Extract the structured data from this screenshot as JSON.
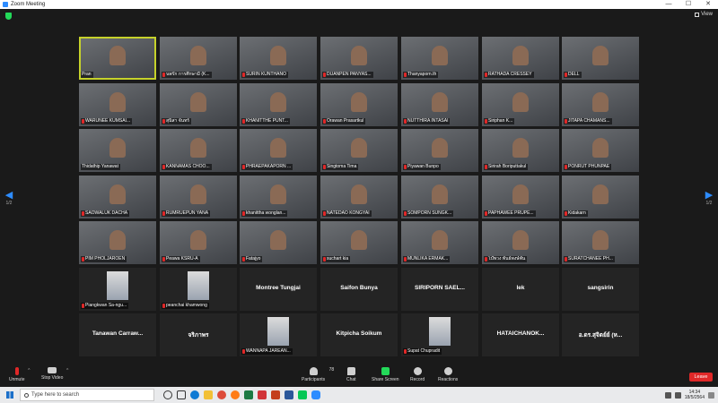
{
  "window": {
    "title": "Zoom Meeting",
    "controls": [
      "—",
      "☐",
      "✕"
    ]
  },
  "topbar": {
    "view_label": "View"
  },
  "pager": {
    "left_page": "1/2",
    "right_page": "1/2",
    "left_arrow": "◀",
    "right_arrow": "▶"
  },
  "tiles": [
    {
      "name": "Pran",
      "type": "video",
      "muted": false,
      "active": true
    },
    {
      "name": "นพรัก การศึกษามี (K...",
      "type": "video",
      "muted": true
    },
    {
      "name": "SURIN KUNTHANO",
      "type": "video",
      "muted": true
    },
    {
      "name": "DUANPEN PANYAS...",
      "type": "video",
      "muted": true
    },
    {
      "name": "Thanyaporn.th",
      "type": "video",
      "muted": true
    },
    {
      "name": "RATHADA CRESSEY",
      "type": "video",
      "muted": true
    },
    {
      "name": "DELL",
      "type": "video",
      "muted": true
    },
    {
      "name": "WARUNEE KUMSAI...",
      "type": "video",
      "muted": true
    },
    {
      "name": "สุนิสา จันทร์",
      "type": "video",
      "muted": true
    },
    {
      "name": "KHANITTHE PUNT...",
      "type": "video",
      "muted": true
    },
    {
      "name": "Orawan Prasartkul",
      "type": "video",
      "muted": true
    },
    {
      "name": "NUTTHIRA INTASAI",
      "type": "video",
      "muted": true
    },
    {
      "name": "Siriphan K...",
      "type": "video",
      "muted": true
    },
    {
      "name": "JITAPA CHAMANS...",
      "type": "video",
      "muted": true
    },
    {
      "name": "Thidathip Yanawat",
      "type": "video",
      "muted": false
    },
    {
      "name": "KANNAMAS CHOO...",
      "type": "video",
      "muted": true
    },
    {
      "name": "PHRAEPAKAPORN ...",
      "type": "video",
      "muted": true
    },
    {
      "name": "Singtoma Tima",
      "type": "video",
      "muted": true
    },
    {
      "name": "Piyawan Bunpo",
      "type": "video",
      "muted": true
    },
    {
      "name": "Sirirah Boriputtakul",
      "type": "video",
      "muted": true
    },
    {
      "name": "PONRUT PHUNPAE",
      "type": "video",
      "muted": true
    },
    {
      "name": "SAOWALUK DACHA",
      "type": "video",
      "muted": true
    },
    {
      "name": "RUMRUEPUN YANA",
      "type": "video",
      "muted": true
    },
    {
      "name": "khanittha wonglan...",
      "type": "video",
      "muted": true
    },
    {
      "name": "NATEDAO KONGYAI",
      "type": "video",
      "muted": true
    },
    {
      "name": "SOMPORN SUNGK...",
      "type": "video",
      "muted": true
    },
    {
      "name": "PAPHAWEE PRUPE...",
      "type": "video",
      "muted": true
    },
    {
      "name": "Kidakarn",
      "type": "video",
      "muted": true
    },
    {
      "name": "PIM PHOLJAROEN",
      "type": "video",
      "muted": true
    },
    {
      "name": "Peawa KSRU-A",
      "type": "video",
      "muted": true
    },
    {
      "name": "Fatajyo",
      "type": "video",
      "muted": true
    },
    {
      "name": "suchart kia",
      "type": "video",
      "muted": true
    },
    {
      "name": "MUNLIKA ERMAK...",
      "type": "video",
      "muted": true
    },
    {
      "name": "โบ๊พวง พันธ์พงษ์พัน",
      "type": "video",
      "muted": true
    },
    {
      "name": "SURATCHANEE PH...",
      "type": "video",
      "muted": true
    },
    {
      "name": "Piangkwan Sa-ngu...",
      "type": "photo",
      "muted": true
    },
    {
      "name": "peanchai khamwong",
      "type": "photo",
      "muted": true
    },
    {
      "name": "Montree Tungjai",
      "type": "text",
      "muted": false
    },
    {
      "name": "Saifon Bunya",
      "type": "text",
      "muted": false
    },
    {
      "name": "SIRIPORN SAEL...",
      "type": "text",
      "muted": false
    },
    {
      "name": "lek",
      "type": "text",
      "muted": false
    },
    {
      "name": "sangsirin",
      "type": "text",
      "muted": false
    },
    {
      "name": "Tanawan Carraw...",
      "type": "text",
      "muted": false
    },
    {
      "name": "จริภาพร",
      "type": "text",
      "muted": false
    },
    {
      "name": "WANNAPA JAREAN...",
      "type": "photo",
      "muted": true
    },
    {
      "name": "Kitpicha Soikum",
      "type": "text",
      "muted": false
    },
    {
      "name": "Supat Chupradit",
      "type": "photo",
      "muted": true
    },
    {
      "name": "HATAICHANOK...",
      "type": "text",
      "muted": false
    },
    {
      "name": "อ.ดร.สุจิตย์ย์ (ห...",
      "type": "text",
      "muted": false
    }
  ],
  "controls": {
    "unmute": "Unmute",
    "stop_video": "Stop Video",
    "participants": "Participants",
    "participants_count": "78",
    "chat": "Chat",
    "share_screen": "Share Screen",
    "record": "Record",
    "reactions": "Reactions",
    "leave": "Leave"
  },
  "taskbar": {
    "search_placeholder": "Type here to search",
    "time": "14:34",
    "date": "18/5/2564"
  },
  "colors": {
    "active_speaker": "#c6d22b",
    "mic_muted": "#e02828",
    "share": "#23d959",
    "leave": "#e02828",
    "accent": "#2d8cff"
  }
}
